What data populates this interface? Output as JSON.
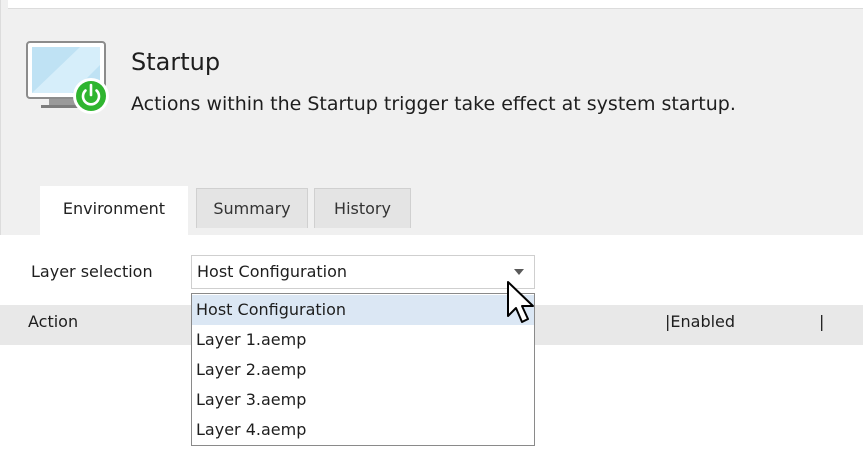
{
  "header": {
    "title": "Startup",
    "description": "Actions within the Startup trigger take effect at system startup."
  },
  "tabs": [
    {
      "label": "Environment",
      "active": true
    },
    {
      "label": "Summary",
      "active": false
    },
    {
      "label": "History",
      "active": false
    }
  ],
  "layer_selection": {
    "label": "Layer selection",
    "value": "Host Configuration",
    "options": [
      "Host Configuration",
      "Layer 1.aemp",
      "Layer 2.aemp",
      "Layer 3.aemp",
      "Layer 4.aemp"
    ],
    "highlighted_option": "Host Configuration"
  },
  "grid": {
    "columns": [
      "Action",
      "|Enabled",
      "|"
    ]
  },
  "icons": {
    "monitor": "monitor-icon",
    "power": "power-icon",
    "dropdown_arrow": "chevron-down-icon",
    "cursor": "mouse-pointer-icon"
  },
  "colors": {
    "power_green": "#2fb52f",
    "highlight": "#dbe7f4"
  }
}
